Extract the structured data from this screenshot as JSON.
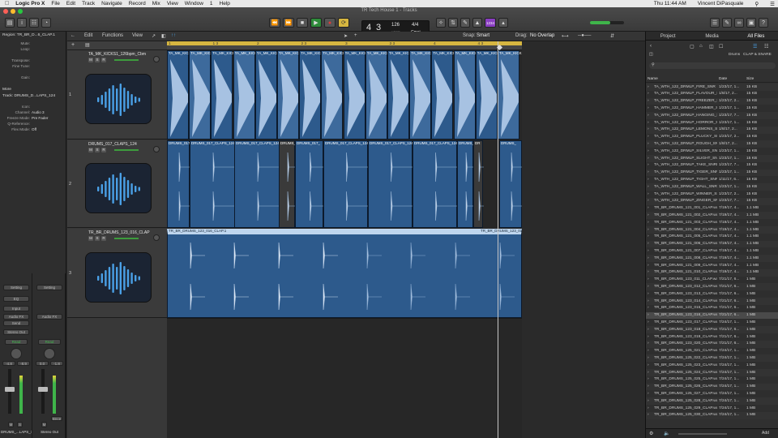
{
  "menubar": {
    "app": "Logic Pro X",
    "items": [
      "File",
      "Edit",
      "Track",
      "Navigate",
      "Record",
      "Mix",
      "View",
      "Window",
      "1",
      "Help"
    ],
    "clock": "Thu 11:44 AM",
    "user": "Vincent DiPasquale"
  },
  "window": {
    "title": "TR Tech House 1 - Tracks"
  },
  "lcd": {
    "bar": "4",
    "beat": "3",
    "tempo": "126",
    "tempo_label": "KEEP",
    "sig": "4/4",
    "key": "Cmaj"
  },
  "transport_badge": "1234",
  "toolbar": {
    "edit": "Edit",
    "functions": "Functions",
    "view": "View",
    "snap_label": "Snap:",
    "snap_value": "Smart",
    "drag_label": "Drag:",
    "drag_value": "No Overlap"
  },
  "ruler_ticks": [
    "1",
    "1 3",
    "2",
    "2 3",
    "3",
    "3 3",
    "4",
    "4 3",
    "5",
    "5 3"
  ],
  "inspector": {
    "region_title": "Region: TR_BR_D...6_CLAP.1",
    "rows": [
      {
        "k": "Mute:",
        "v": ""
      },
      {
        "k": "Loop:",
        "v": ""
      },
      {
        "k": "",
        "v": ""
      },
      {
        "k": "Transpose:",
        "v": ""
      },
      {
        "k": "Fine Tune:",
        "v": ""
      },
      {
        "k": "",
        "v": ""
      },
      {
        "k": "Gain:",
        "v": ""
      }
    ],
    "more": "More",
    "track_title": "Track: DRUMS_D...LAPS_124",
    "track_rows": [
      {
        "k": "Icon:",
        "v": ""
      },
      {
        "k": "Channel:",
        "v": "Audio 3"
      },
      {
        "k": "Freeze Mode:",
        "v": "Pre Fader"
      },
      {
        "k": "Q-Reference:",
        "v": ""
      },
      {
        "k": "Flex Mode:",
        "v": "Off"
      }
    ]
  },
  "strips": [
    {
      "setting": "Setting",
      "eq": "EQ",
      "input": "Input",
      "audiofx": "Audio FX",
      "send": "Send",
      "output": "Stereo Out",
      "mode": "Read",
      "pan": "",
      "val1": "-4.8",
      "val2": "-8.9",
      "name": "DRUMS_...LAPS_124",
      "m": "M",
      "s": "S"
    },
    {
      "setting": "Setting",
      "eq": "",
      "input": "",
      "audiofx": "Audio FX",
      "send": "",
      "output": "",
      "mode": "Read",
      "pan": "",
      "val1": "0.0",
      "val2": "-1.8",
      "name": "Stereo Out",
      "m": "M",
      "s": "",
      "bnce": "Bnce"
    }
  ],
  "tracks": [
    {
      "num": "1",
      "name": "TA_MK_KICKS1_126bpm_Cbm"
    },
    {
      "num": "2",
      "name": "DRUMS_017_CLAPS_124"
    },
    {
      "num": "3",
      "name": "TR_BR_DRUMS_123_016_CLAP"
    }
  ],
  "regions": {
    "track1": [
      "TA_MK_KICK",
      "TA_MK_KICK",
      "TA_MK_KICK",
      "TA_MK_KICK",
      "TA_MK_KICK",
      "TA_MK_KICK",
      "TA_MK_KICK",
      "TA_MK_KICK",
      "TA_MK_KICK",
      "TA_MK_KICK",
      "TA_MK_KICK",
      "TA_MK_KICK",
      "TA_MK_KICK",
      "TA_MK_KICK",
      "TA_MK_KICK",
      "TA_MK_KICK"
    ],
    "track2": [
      "DRUMS_017_",
      "DRUMS_017_CLAPS_124.9",
      "DRUMS_017_CLAPS_124.5",
      "DRUMS_",
      "DRUMS_017_",
      "DRUMS_017_CLAPS_124.11",
      "DRUMS_017_CLAPS_124.13",
      "DRUMS_017_CLAPS_124.15",
      "DRUMS_",
      "DR",
      "DRUMS_"
    ],
    "track3_a": "TR_BR_DRUMS_123_016_CLAP.1",
    "track3_b": "TR_BR_DRUMS_123_016_"
  },
  "browser": {
    "tabs": [
      "Project",
      "Media",
      "All Files"
    ],
    "path": [
      "Drums",
      "CLAP & SNARE"
    ],
    "cols": [
      "Name",
      "Date",
      "Size"
    ],
    "files": [
      [
        "TA_WTH_122_DRMLP_FIRE_SNR",
        "1/23/17, 1...",
        "15 KB"
      ],
      [
        "TA_WTH_122_DRMLP_FLAVOUR_S",
        "1/8/17, 2...",
        "15 KB"
      ],
      [
        "TA_WTH_122_DRMLP_FREEZER_S",
        "1/23/17, 2...",
        "15 KB"
      ],
      [
        "TA_WTH_122_DRMLP_HAMMER_S",
        "1/23/17, 1...",
        "15 KB"
      ],
      [
        "TA_WTH_122_DRMLP_HANGING_S",
        "1/23/17, 7...",
        "15 KB"
      ],
      [
        "TA_WTH_122_DRMLP_HORROR_S",
        "1/23/17, 1...",
        "15 KB"
      ],
      [
        "TA_WTH_122_DRMLP_LEMONS_SI",
        "1/8/17, 2...",
        "15 KB"
      ],
      [
        "TA_WTH_122_DRMLP_PLUCKY_SN",
        "1/23/17, 2...",
        "15 KB"
      ],
      [
        "TA_WTH_122_DRMLP_ROUGH_SNR",
        "1/8/17, 2...",
        "15 KB"
      ],
      [
        "TA_WTH_122_DRMLP_SILVER_SNF",
        "1/23/17, 1...",
        "15 KB"
      ],
      [
        "TA_WTH_122_DRMLP_SLIGHT_SNR",
        "1/23/17, 1...",
        "15 KB"
      ],
      [
        "TA_WTH_122_DRMLP_TAKE_SNRE",
        "1/23/17, 7...",
        "15 KB"
      ],
      [
        "TA_WTH_122_DRMLP_TIGER_SNR",
        "1/23/17, 1...",
        "15 KB"
      ],
      [
        "TA_WTH_122_DRMLP_TIGHT_SNR",
        "1/11/17, 6...",
        "15 KB"
      ],
      [
        "TA_WTH_122_DRMLP_WALL_SNRE",
        "1/23/17, 1...",
        "15 KB"
      ],
      [
        "TA_WTH_122_DRMLP_WINNER_SN",
        "1/23/17, 2...",
        "15 KB"
      ],
      [
        "TA_WTH_122_DRMLP_ZINGER_SN",
        "1/23/17, 7...",
        "15 KB"
      ],
      [
        "TR_BR_DRUMS_121_001_CLAP.wa",
        "7/19/17, 4...",
        "1.1 MB"
      ],
      [
        "TR_BR_DRUMS_121_002_CLAP.wa",
        "7/19/17, 4...",
        "1.1 MB"
      ],
      [
        "TR_BR_DRUMS_121_003_CLAP.wa",
        "7/19/17, 4...",
        "1.1 MB"
      ],
      [
        "TR_BR_DRUMS_121_004_CLAP.wa",
        "7/19/17, 4...",
        "1.1 MB"
      ],
      [
        "TR_BR_DRUMS_121_005_CLAP.wa",
        "7/19/17, 4...",
        "1.1 MB"
      ],
      [
        "TR_BR_DRUMS_121_006_CLAP.wa",
        "7/19/17, 4...",
        "1.1 MB"
      ],
      [
        "TR_BR_DRUMS_121_007_CLAP.wa",
        "7/19/17, 4...",
        "1.1 MB"
      ],
      [
        "TR_BR_DRUMS_121_008_CLAP.wa",
        "7/19/17, 4...",
        "1.1 MB"
      ],
      [
        "TR_BR_DRUMS_121_009_CLAP.wa",
        "7/19/17, 4...",
        "1.1 MB"
      ],
      [
        "TR_BR_DRUMS_121_010_CLAP.wa",
        "7/19/17, 4...",
        "1.1 MB"
      ],
      [
        "TR_BR_DRUMS_123_011_CLAP.wa",
        "7/21/17, 6...",
        "1 MB"
      ],
      [
        "TR_BR_DRUMS_123_012_CLAP.wa",
        "7/21/17, 6...",
        "1 MB"
      ],
      [
        "TR_BR_DRUMS_123_013_CLAP.wa",
        "7/21/17, 6...",
        "1 MB"
      ],
      [
        "TR_BR_DRUMS_123_014_CLAP.wa",
        "7/21/17, 6...",
        "1 MB"
      ],
      [
        "TR_BR_DRUMS_123_015_CLAP.wa",
        "7/21/17, 6...",
        "1 MB"
      ],
      [
        "TR_BR_DRUMS_123_016_CLAP.wa",
        "7/21/17, 6...",
        "1 MB"
      ],
      [
        "TR_BR_DRUMS_123_017_CLAP.wa",
        "7/24/17, 1...",
        "1 MB"
      ],
      [
        "TR_BR_DRUMS_123_018_CLAP.wa",
        "7/21/17, 6...",
        "1 MB"
      ],
      [
        "TR_BR_DRUMS_123_019_CLAP.wa",
        "7/21/17, 6...",
        "1 MB"
      ],
      [
        "TR_BR_DRUMS_123_020_CLAP.wa",
        "7/21/17, 6...",
        "1 MB"
      ],
      [
        "TR_BR_DRUMS_125_021_CLAP.wa",
        "7/24/17, 1...",
        "1 MB"
      ],
      [
        "TR_BR_DRUMS_125_022_CLAP.wa",
        "7/24/17, 1...",
        "1 MB"
      ],
      [
        "TR_BR_DRUMS_125_023_CLAP.wa",
        "7/24/17, 1...",
        "1 MB"
      ],
      [
        "TR_BR_DRUMS_125_024_CLAP.wa",
        "7/24/17, 1...",
        "1 MB"
      ],
      [
        "TR_BR_DRUMS_125_025_CLAP.wa",
        "7/24/17, 1...",
        "1 MB"
      ],
      [
        "TR_BR_DRUMS_125_026_CLAP.wa",
        "7/24/17, 1...",
        "1 MB"
      ],
      [
        "TR_BR_DRUMS_125_027_CLAP.wa",
        "7/24/17, 1...",
        "1 MB"
      ],
      [
        "TR_BR_DRUMS_125_028_CLAP.wa",
        "7/24/17, 1...",
        "1 MB"
      ],
      [
        "TR_BR_DRUMS_125_029_CLAP.wa",
        "7/24/17, 1...",
        "1 MB"
      ],
      [
        "TR_BR_DRUMS_125_030_CLAP.wa",
        "7/24/17, 1...",
        "1 MB"
      ]
    ],
    "selected_index": 32,
    "add": "Add"
  },
  "colors": {
    "region": "#2d5a8c",
    "region_light": "#5d88b8",
    "region_gray": "#3a3a3a",
    "cycle": "#d6b640",
    "accent": "#4aa0e6"
  }
}
